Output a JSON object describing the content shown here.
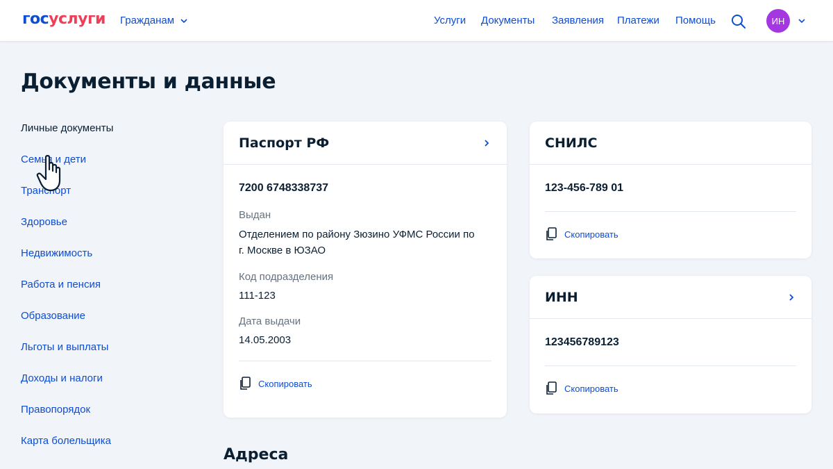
{
  "header": {
    "logo_part1": "гос",
    "logo_part2": "услуги",
    "audience": "Гражданам",
    "nav": [
      "Услуги",
      "Документы",
      "Заявления",
      "Платежи",
      "Помощь"
    ],
    "avatar_initials": "ИН"
  },
  "page_title": "Документы и данные",
  "sidebar": {
    "items": [
      {
        "label": "Личные документы"
      },
      {
        "label": "Семья и дети"
      },
      {
        "label": "Транспорт"
      },
      {
        "label": "Здоровье"
      },
      {
        "label": "Недвижимость"
      },
      {
        "label": "Работа и пенсия"
      },
      {
        "label": "Образование"
      },
      {
        "label": "Льготы и выплаты"
      },
      {
        "label": "Доходы и налоги"
      },
      {
        "label": "Правопорядок"
      },
      {
        "label": "Карта болельщика"
      }
    ]
  },
  "passport": {
    "title": "Паспорт РФ",
    "number": "7200 6748338737",
    "issued_label": "Выдан",
    "issued_by": "Отделением по району Зюзино УФМС России по г. Москве в ЮЗАО",
    "dept_code_label": "Код подразделения",
    "dept_code": "111-123",
    "issue_date_label": "Дата выдачи",
    "issue_date": "14.05.2003",
    "copy_label": "Скопировать"
  },
  "snils": {
    "title": "СНИЛС",
    "number": "123-456-789 01",
    "copy_label": "Скопировать"
  },
  "inn": {
    "title": "ИНН",
    "number": "123456789123",
    "copy_label": "Скопировать"
  },
  "addresses_title": "Адреса",
  "colors": {
    "brand_blue": "#0d4cd3",
    "brand_red": "#ee3f58",
    "avatar": "#a437e0",
    "background": "#f1f4f9"
  }
}
